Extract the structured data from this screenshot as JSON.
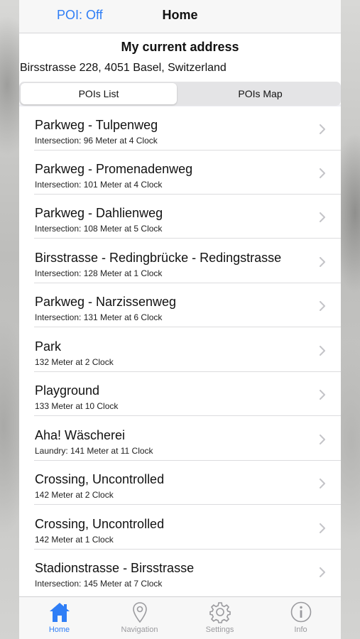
{
  "nav": {
    "left_label": "POI: Off",
    "title": "Home"
  },
  "header": {
    "title": "My current address",
    "address": "Birsstrasse 228, 4051 Basel, Switzerland"
  },
  "segments": {
    "list_label": "POIs List",
    "map_label": "POIs Map",
    "selected": "POIs List"
  },
  "poi_list": [
    {
      "title": "Parkweg - Tulpenweg",
      "detail": "Intersection: 96 Meter at 4 Clock"
    },
    {
      "title": "Parkweg - Promenadenweg",
      "detail": "Intersection: 101 Meter at 4 Clock"
    },
    {
      "title": "Parkweg - Dahlienweg",
      "detail": "Intersection: 108 Meter at 5 Clock"
    },
    {
      "title": "Birsstrasse - Redingbrücke - Redingstrasse",
      "detail": "Intersection: 128 Meter at 1 Clock"
    },
    {
      "title": "Parkweg - Narzissenweg",
      "detail": "Intersection: 131 Meter at 6 Clock"
    },
    {
      "title": "Park",
      "detail": "132 Meter at 2 Clock"
    },
    {
      "title": "Playground",
      "detail": "133 Meter at 10 Clock"
    },
    {
      "title": "Aha! Wäscherei",
      "detail": "Laundry: 141 Meter at 11 Clock"
    },
    {
      "title": "Crossing, Uncontrolled",
      "detail": "142 Meter at 2 Clock"
    },
    {
      "title": "Crossing, Uncontrolled",
      "detail": "142 Meter at 1 Clock"
    },
    {
      "title": "Stadionstrasse - Birsstrasse",
      "detail": "Intersection: 145 Meter at 7 Clock"
    }
  ],
  "tabbar": {
    "home": {
      "label": "Home",
      "icon": "house-icon"
    },
    "navigation": {
      "label": "Navigation",
      "icon": "location-pin-icon"
    },
    "settings": {
      "label": "Settings",
      "icon": "gear-icon"
    },
    "info": {
      "label": "Info",
      "icon": "info-icon"
    },
    "active": "Home"
  },
  "colors": {
    "accent": "#2f7ef6",
    "inactive": "#9a9a9e"
  }
}
